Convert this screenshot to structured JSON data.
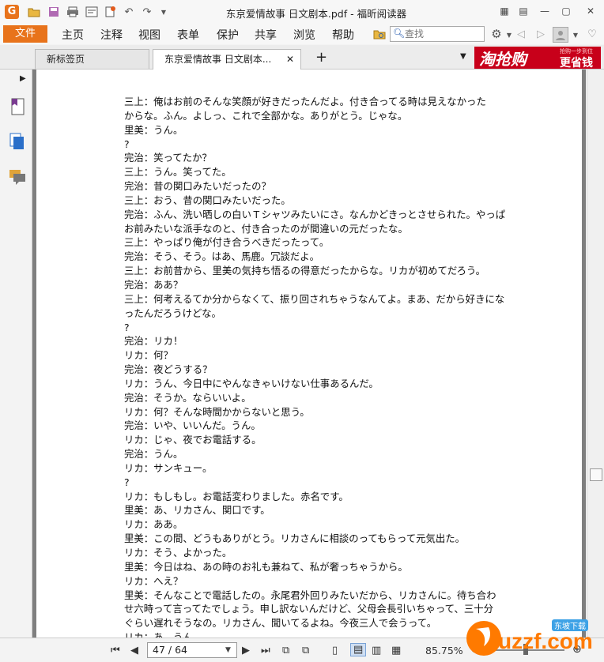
{
  "window": {
    "title": "东京爱情故事 日文剧本.pdf - 福昕阅读器"
  },
  "menu": {
    "file": "文件",
    "items": [
      "主页",
      "注释",
      "视图",
      "表单",
      "保护",
      "共享",
      "浏览",
      "帮助"
    ]
  },
  "search": {
    "placeholder": "查找"
  },
  "tabs": [
    {
      "label": "新标签页"
    },
    {
      "label": "东京爱情故事 日文剧本..."
    }
  ],
  "ad": {
    "main": "淘抢购",
    "tag": "更省钱",
    "small": "抢购一步到位"
  },
  "document": {
    "lines": [
      "三上：俺はお前のそんな笑顔が好きだったんだよ。付き合ってる時は見えなかった",
      "からな。ふん。よしっ、これで全部かな。ありがとう。じゃな。",
      "里美：うん。",
      "?",
      "完治：笑ってたか？",
      "三上：うん。笑ってた。",
      "完治：昔の関口みたいだったの？",
      "三上：おう、昔の関口みたいだった。",
      "完治：ふん、洗い晒しの白いＴシャツみたいにさ。なんかどきっとさせられた。やっぱ",
      "お前みたいな派手なのと、付き合ったのが間違いの元だったな。",
      "三上：やっぱり俺が付き合うべきだったって。",
      "完治：そう、そう。はあ、馬鹿。冗談だよ。",
      "三上：お前昔から、里美の気持ち悟るの得意だったからな。リカが初めてだろう。",
      "完治：ああ？",
      "三上：何考えるてか分からなくて、振り回されちゃうなんてよ。まあ、だから好きにな",
      "ったんだろうけどな。",
      "?",
      "完治：リカ！",
      "リカ：何？",
      "完治：夜どうする？",
      "リカ：うん、今日中にやんなきゃいけない仕事あるんだ。",
      "完治：そうか。ならいいよ。",
      "リカ：何？そんな時間かからないと思う。",
      "完治：いや、いいんだ。うん。",
      "リカ：じゃ、夜でお電話する。",
      "完治：うん。",
      "リカ：サンキュー。",
      "?",
      "リカ：もしもし。お電話変わりました。赤名です。",
      "里美：あ、リカさん、関口です。",
      "リカ：ああ。",
      "里美：この間、どうもありがとう。リカさんに相談のってもらって元気出た。",
      "リカ：そう、よかった。",
      "里美：今日はね、あの時のお礼も兼ねて、私が奢っちゃうから。",
      "リカ：へえ？",
      "里美：そんなことで電話したの。永尾君外回りみたいだから、リカさんに。待ち合わ",
      "せ六時って言ってたでしょう。申し訳ないんだけど、父母会長引いちゃって、三十分",
      "ぐらい遅れそうなの。リカさん、聞いてるよね。今夜三人で会うって。",
      "リカ：あ、うん。"
    ]
  },
  "status": {
    "page_input": "47 / 64",
    "zoom": "85.75%"
  },
  "watermark": {
    "text": "uzzf.com",
    "tag": "东坡下载"
  }
}
